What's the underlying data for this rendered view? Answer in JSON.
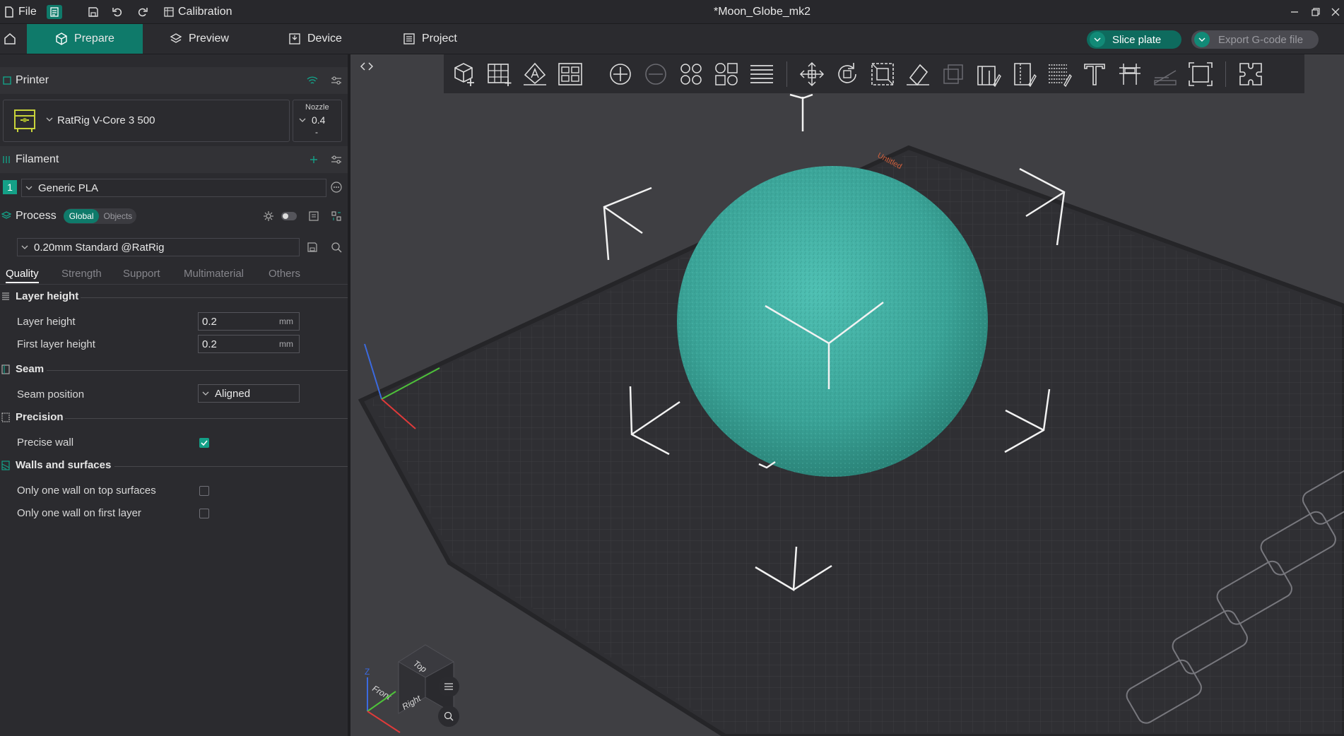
{
  "titlebar": {
    "file_label": "File",
    "calibration_label": "Calibration",
    "window_title": "*Moon_Globe_mk2"
  },
  "tabs": {
    "prepare": "Prepare",
    "preview": "Preview",
    "device": "Device",
    "project": "Project",
    "slice_plate": "Slice plate",
    "export_gcode": "Export G-code file"
  },
  "printer": {
    "header": "Printer",
    "name": "RatRig V-Core 3 500",
    "nozzle_label": "Nozzle",
    "nozzle_value": "0.4",
    "nozzle_sub": "-"
  },
  "filament": {
    "header": "Filament",
    "index": "1",
    "name": "Generic PLA"
  },
  "process": {
    "header": "Process",
    "global": "Global",
    "objects": "Objects",
    "preset": "0.20mm Standard @RatRig",
    "tabs": [
      "Quality",
      "Strength",
      "Support",
      "Multimaterial",
      "Others"
    ]
  },
  "settings": {
    "layer_height_group": "Layer height",
    "layer_height_label": "Layer height",
    "layer_height_value": "0.2",
    "first_layer_label": "First layer height",
    "first_layer_value": "0.2",
    "unit": "mm",
    "seam_group": "Seam",
    "seam_position_label": "Seam position",
    "seam_position_value": "Aligned",
    "precision_group": "Precision",
    "precise_wall_label": "Precise wall",
    "precise_wall_checked": true,
    "walls_group": "Walls and surfaces",
    "one_wall_top_label": "Only one wall on top surfaces",
    "one_wall_top_checked": false,
    "one_wall_first_label": "Only one wall on first layer",
    "one_wall_first_checked": false
  },
  "viewport": {
    "plate_label": "Untitled",
    "cube_top": "Top",
    "cube_front": "Front",
    "cube_right": "Right",
    "axis_z": "Z",
    "model_color": "#3fa89c",
    "accent": "#0f7a6a"
  }
}
